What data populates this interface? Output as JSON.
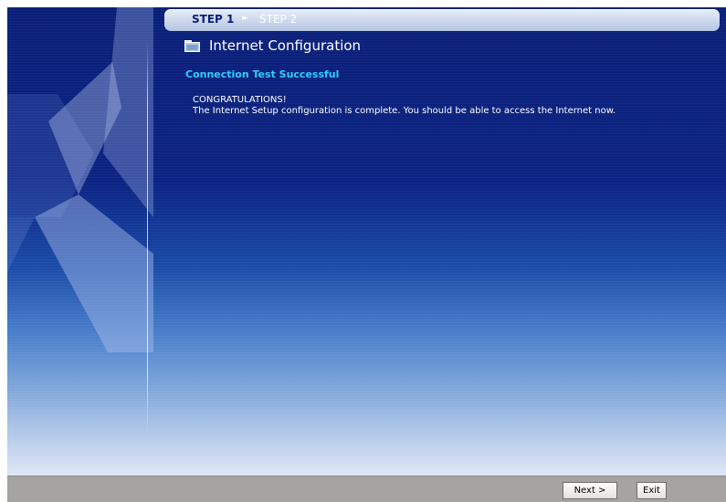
{
  "wizard": {
    "steps": [
      {
        "label": "STEP 1",
        "active": true
      },
      {
        "label": "STEP 2",
        "active": false
      }
    ],
    "step_separator_icon": "arrow-right-icon",
    "page_title": "Internet Configuration",
    "page_icon": "folder-icon",
    "section_heading": "Connection Test Successful",
    "message_title": "CONGRATULATIONS!",
    "message_body": "The Internet Setup configuration is complete. You should be able to access the Internet now."
  },
  "footer": {
    "next_label": "Next >",
    "exit_label": "Exit"
  },
  "colors": {
    "background_top": "#0a1f78",
    "background_bottom": "#e4ebf6",
    "heading_accent": "#33ccff",
    "footer_bar": "#a6a4a2"
  }
}
